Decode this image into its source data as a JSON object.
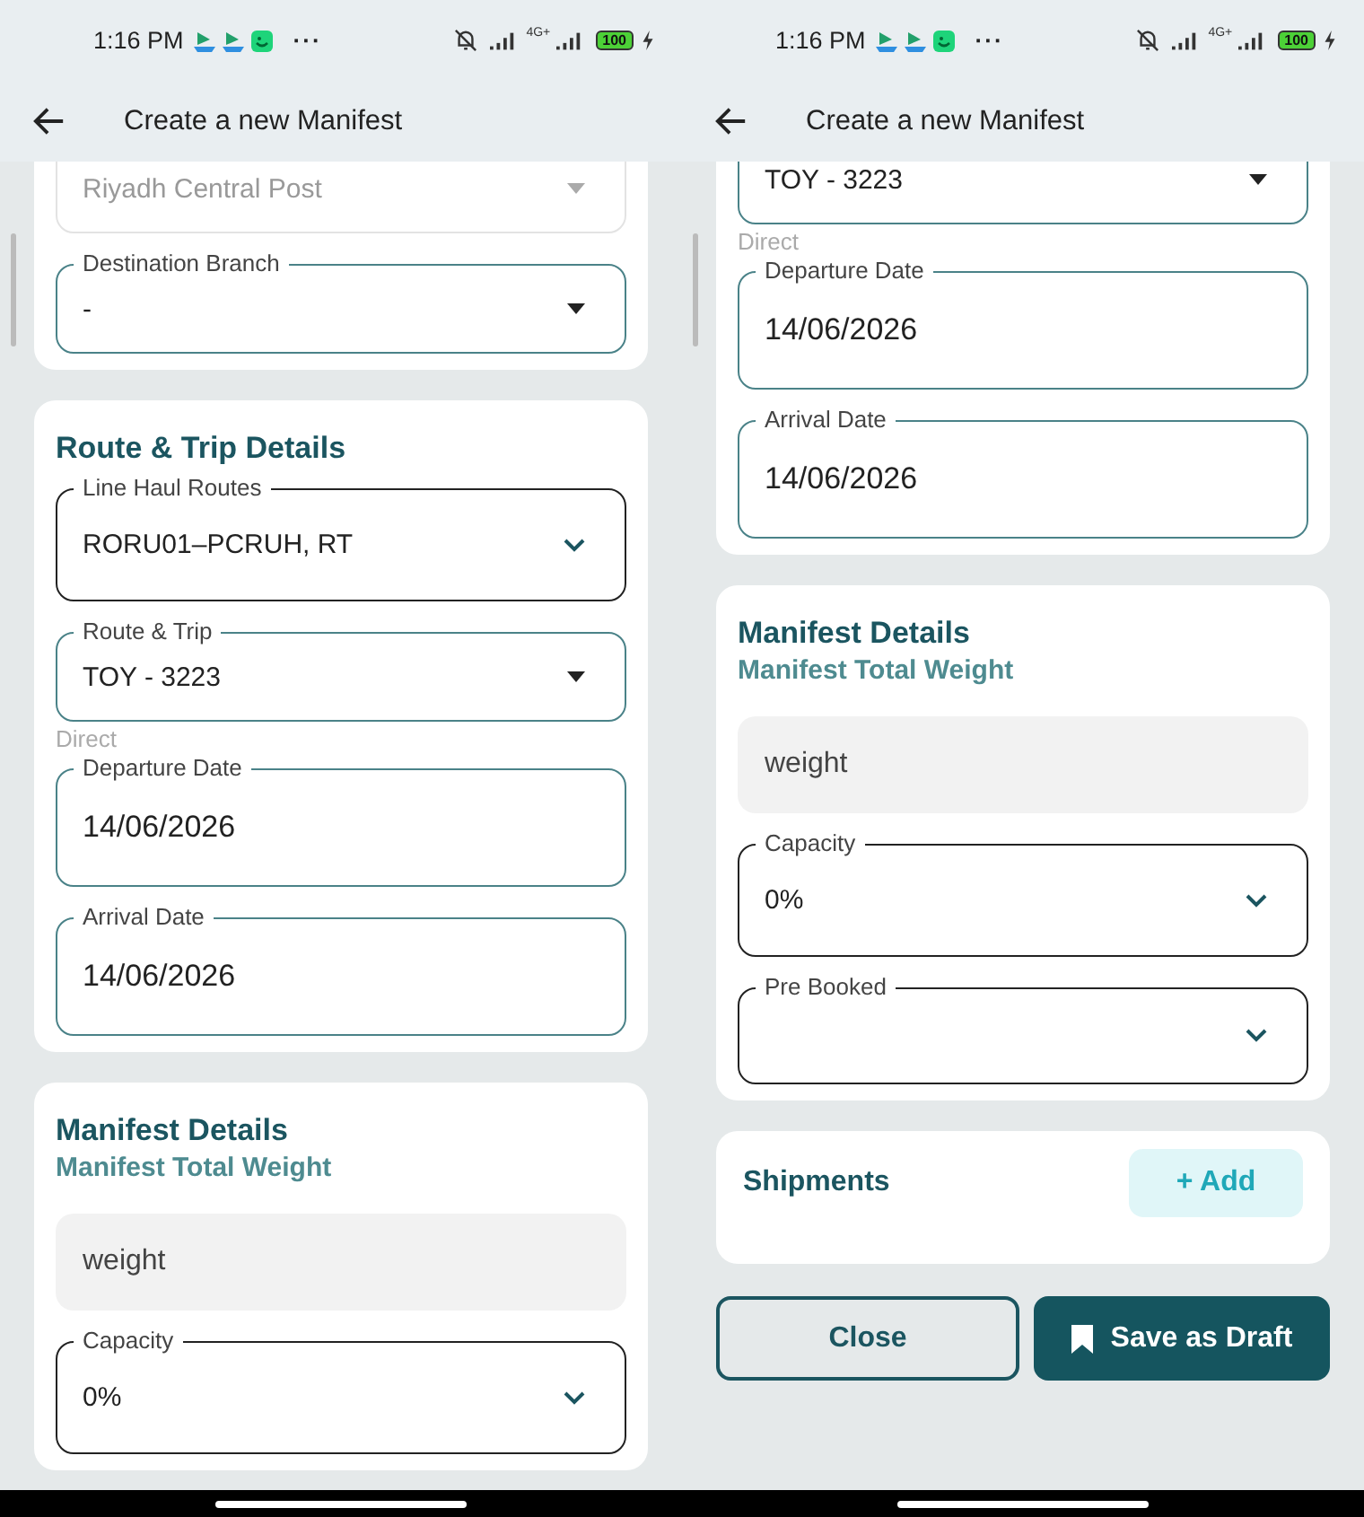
{
  "screens": [
    {
      "status_bar": {
        "time": "1:16 PM",
        "more": "···",
        "network": "4G+",
        "battery": "100"
      },
      "app_bar": {
        "title": "Create a new Manifest"
      },
      "cards": [
        {
          "fields": [
            {
              "kind": "select",
              "value": "Riyadh Central Post",
              "disabled": true
            },
            {
              "kind": "select",
              "label": "Destination Branch",
              "value": "-",
              "disabled": false
            }
          ]
        },
        {
          "title": "Route & Trip Details",
          "fields": [
            {
              "kind": "dropdown",
              "label": "Line Haul Routes",
              "value": "RORU01–PCRUH, RT",
              "disabled": false
            },
            {
              "kind": "select",
              "label": "Route & Trip",
              "value": "TOY - 3223",
              "disabled": false
            },
            {
              "kind": "helper",
              "text": "Direct"
            },
            {
              "kind": "date",
              "label": "Departure Date",
              "value": "14/06/2026",
              "disabled": false
            },
            {
              "kind": "date",
              "label": "Arrival Date",
              "value": "14/06/2026",
              "disabled": false
            }
          ]
        },
        {
          "title": "Manifest Details",
          "subtitle": "Manifest Total Weight",
          "fields": [
            {
              "kind": "text",
              "placeholder": "weight"
            },
            {
              "kind": "dropdown",
              "label": "Capacity",
              "value": "0%",
              "disabled": false
            }
          ]
        }
      ]
    },
    {
      "status_bar": {
        "time": "1:16 PM",
        "more": "···",
        "network": "4G+",
        "battery": "100"
      },
      "app_bar": {
        "title": "Create a new Manifest"
      },
      "cards": [
        {
          "fields": [
            {
              "kind": "select",
              "value": "TOY - 3223",
              "disabled": false
            },
            {
              "kind": "helper",
              "text": "Direct"
            },
            {
              "kind": "date",
              "label": "Departure Date",
              "value": "14/06/2026",
              "disabled": false
            },
            {
              "kind": "date",
              "label": "Arrival Date",
              "value": "14/06/2026",
              "disabled": false
            }
          ]
        },
        {
          "title": "Manifest Details",
          "subtitle": "Manifest Total Weight",
          "fields": [
            {
              "kind": "text",
              "placeholder": "weight"
            },
            {
              "kind": "dropdown",
              "label": "Capacity",
              "value": "0%",
              "disabled": false
            },
            {
              "kind": "dropdown",
              "label": "Pre Booked",
              "disabled": false
            }
          ]
        },
        {
          "title": "Shipments",
          "action": "+ Add"
        }
      ],
      "actions": [
        {
          "kind": "outline",
          "label": "Close"
        },
        {
          "kind": "primary",
          "label": "Save as Draft"
        }
      ]
    }
  ]
}
